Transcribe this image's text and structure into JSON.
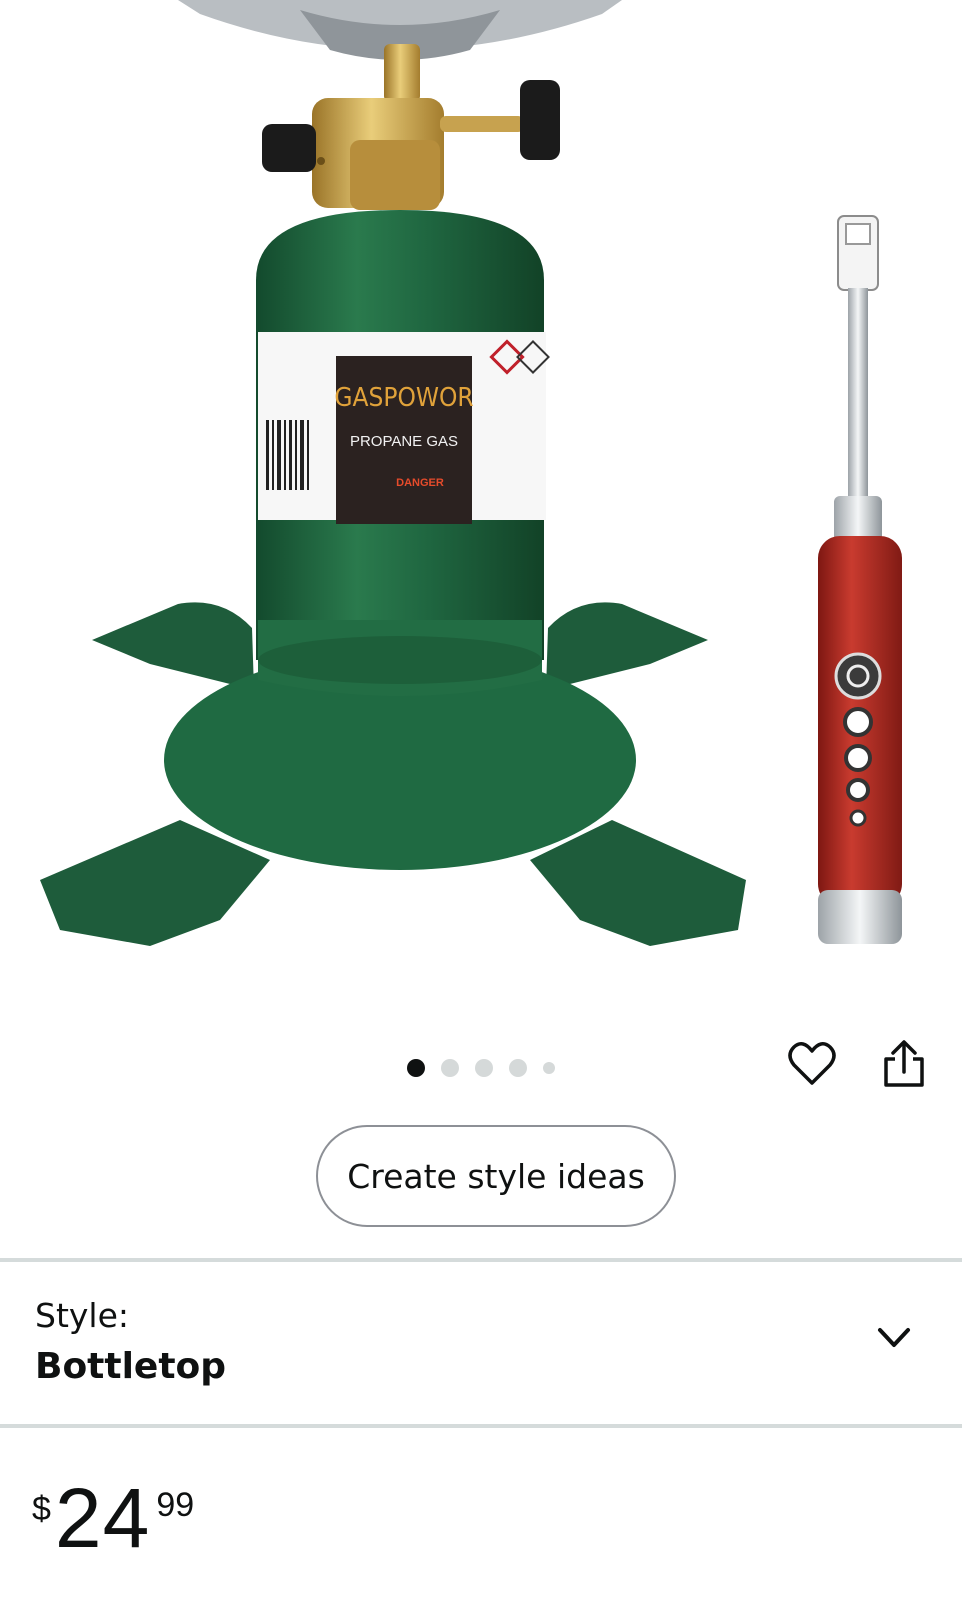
{
  "product_image": {
    "label_brand": "GASPOWOR",
    "label_product": "PROPANE GAS",
    "label_danger": "DANGER"
  },
  "carousel": {
    "count": 5,
    "active_index": 0
  },
  "actions": {
    "wishlist_icon": "heart-icon",
    "share_icon": "share-icon",
    "style_ideas_label": "Create style ideas"
  },
  "style": {
    "label": "Style:",
    "value": "Bottletop",
    "icon": "chevron-down-icon"
  },
  "price": {
    "symbol": "$",
    "whole": "24",
    "fraction": "99"
  },
  "colors": {
    "cylinder_green": "#1e5c3b",
    "brass": "#c9a24b",
    "lighter_red": "#b3261e",
    "divider": "#d5dbdb"
  }
}
